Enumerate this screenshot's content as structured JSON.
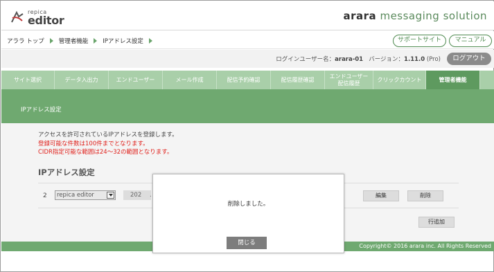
{
  "header": {
    "logo_small": "repica",
    "logo_big": "editor",
    "brand_bold": "arara",
    "brand_rest": "messaging solution"
  },
  "breadcrumb": {
    "items": [
      "アララ トップ",
      "管理者機能",
      "IPアドレス設定"
    ]
  },
  "header_links": {
    "support": "サポートサイト",
    "manual": "マニュアル"
  },
  "login": {
    "user_label": "ログインユーザー名：",
    "user_name": "arara-01",
    "version_label": "バージョン：",
    "version": "1.11.0",
    "edition": "(Pro)",
    "logout": "ログアウト"
  },
  "nav": {
    "tabs": [
      {
        "label": "サイト選択"
      },
      {
        "label": "データ入出力"
      },
      {
        "label": "エンドユーザー"
      },
      {
        "label": "メール作成"
      },
      {
        "label": "配信予約確認"
      },
      {
        "label": "配信履歴確認"
      },
      {
        "label": "エンドユーザー"
      },
      {
        "label": "配信履歴"
      },
      {
        "label": "クリックカウント"
      },
      {
        "label": "管理者機能"
      }
    ]
  },
  "section": {
    "title": "IPアドレス設定"
  },
  "content": {
    "desc1": "アクセスを許可されているIPアドレスを登録します。",
    "desc2": "登録可能な件数は100件までとなります。",
    "desc3": "CIDR指定可能な範囲は24～32の範囲となります。",
    "subtitle": "IPアドレス設定",
    "row_number": "2",
    "site_select": "repica editor",
    "ip_part": "202",
    "ip_dot": ".",
    "edit_button": "編集",
    "delete_button": "削除",
    "add_row_button": "行追加"
  },
  "footer": {
    "copyright": "Copyright© 2016 arara inc. All Rights Reserved"
  },
  "modal": {
    "message": "削除しました。",
    "close_button": "閉じる"
  },
  "colors": {
    "accent_green": "#6fa970",
    "nav_green": "#a9cfa9",
    "active_tab": "#5e9a5f",
    "warning_red": "#e0201b"
  }
}
